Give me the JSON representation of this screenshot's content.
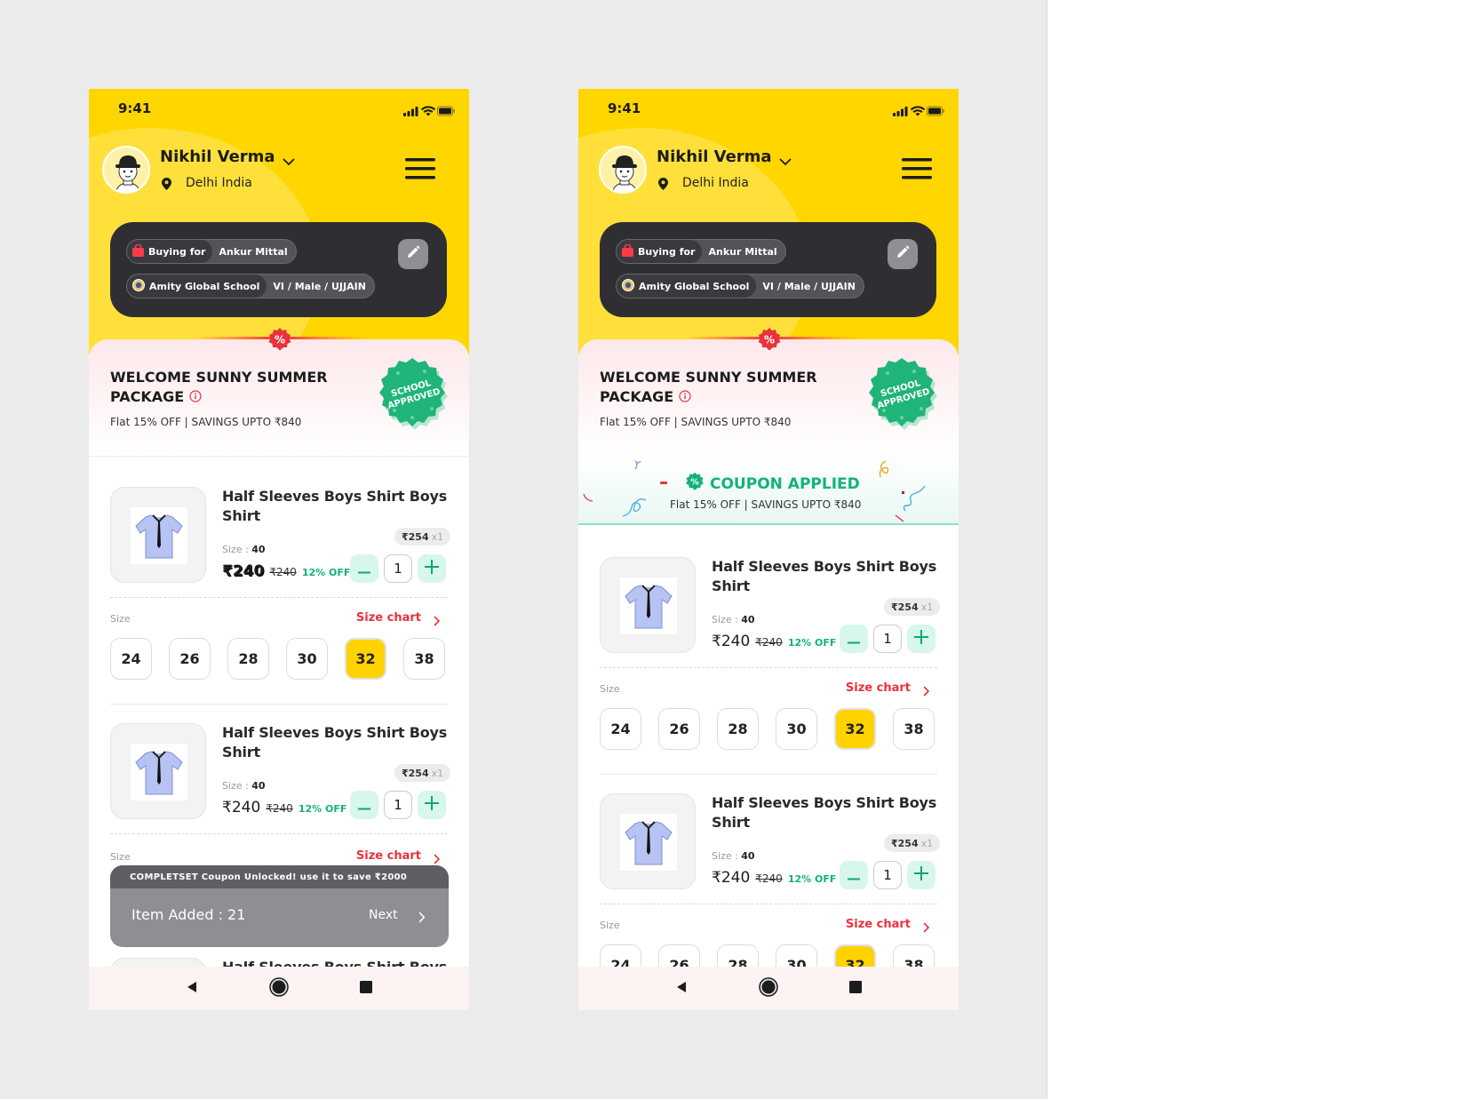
{
  "status": {
    "time": "9:41"
  },
  "user": {
    "name": "Nikhil Verma",
    "location": "Delhi India"
  },
  "buying": {
    "label": "Buying for",
    "person": "Ankur Mittal",
    "school": "Amity Global School",
    "details": "VI / Male / UJJAIN"
  },
  "welcome": {
    "title_line1": "WELCOME SUNNY SUMMER",
    "title_line2": "PACKAGE",
    "subtitle": "Flat 15% OFF | SAVINGS UPTO ₹840",
    "badge_line1": "SCHOOL",
    "badge_line2": "APPROVED"
  },
  "coupon": {
    "title": "COUPON APPLIED",
    "subtitle": "Flat 15% OFF | SAVINGS UPTO ₹840"
  },
  "product": {
    "title": "Half Sleeves Boys Shirt  Boys Shirt",
    "size_label": "Size : ",
    "size_value": "40",
    "unit_price": "₹254",
    "unit_mult": "x1",
    "price": "₹240",
    "old_price": "₹240",
    "discount": "12% OFF",
    "qty": "1"
  },
  "sizes": {
    "label": "Size",
    "chart_link": "Size chart",
    "options": [
      "24",
      "26",
      "28",
      "30",
      "32",
      "38"
    ],
    "selected": "32"
  },
  "toast": {
    "message": "COMPLETSET  Coupon Unlocked! use it to save ₹2000",
    "items": "Item Added : 21",
    "next": "Next"
  },
  "colors": {
    "primary": "#ffd600",
    "dark": "#2f2f33",
    "accent_red": "#e8323c",
    "accent_green": "#12b27a"
  }
}
